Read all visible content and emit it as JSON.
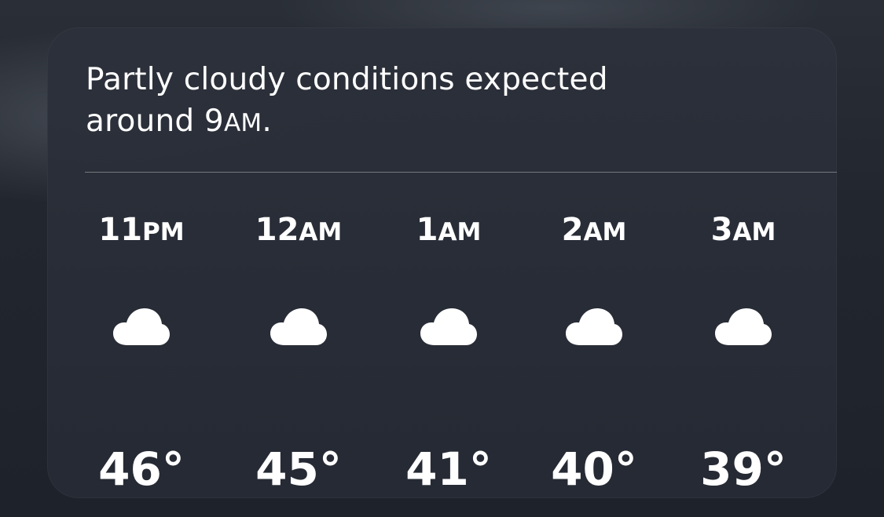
{
  "summary": {
    "text_part1": "Partly cloudy conditions expected around 9",
    "text_ampm": "AM",
    "text_end": "."
  },
  "hourly": [
    {
      "hour": "11",
      "ampm": "PM",
      "icon": "cloud-icon",
      "temp": "46°"
    },
    {
      "hour": "12",
      "ampm": "AM",
      "icon": "cloud-icon",
      "temp": "45°"
    },
    {
      "hour": "1",
      "ampm": "AM",
      "icon": "cloud-icon",
      "temp": "41°"
    },
    {
      "hour": "2",
      "ampm": "AM",
      "icon": "cloud-icon",
      "temp": "40°"
    },
    {
      "hour": "3",
      "ampm": "AM",
      "icon": "cloud-icon",
      "temp": "39°"
    }
  ],
  "colors": {
    "card_background": "#2a2e38",
    "text": "#ffffff",
    "divider": "#6b6f78"
  }
}
